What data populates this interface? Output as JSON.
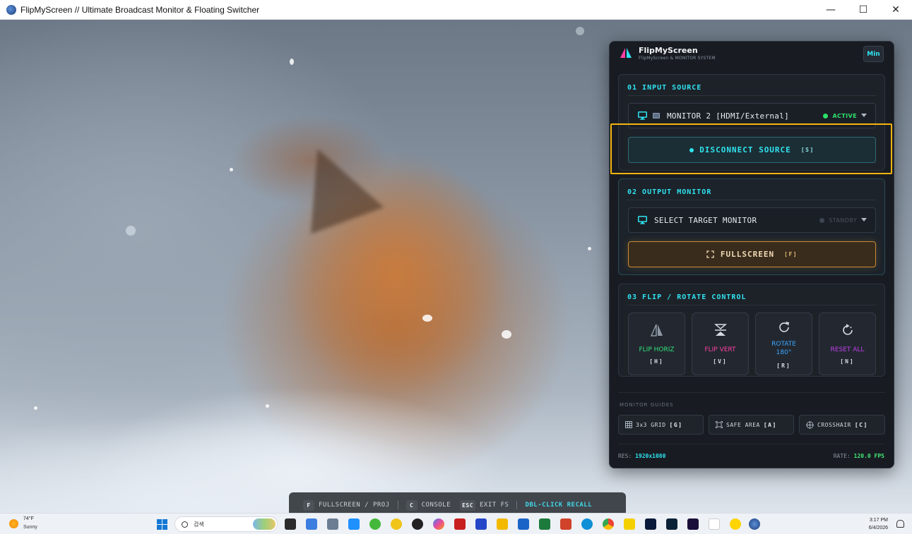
{
  "window": {
    "title": "FlipMyScreen // Ultimate Broadcast Monitor & Floating Switcher",
    "controls": {
      "minimize": "—",
      "maximize": "☐",
      "close": "✕"
    }
  },
  "panel": {
    "brand_title": "FlipMyScreen",
    "brand_subtitle": "FlipMyScreen & MONITOR SYSTEM",
    "min_label": "Min",
    "input": {
      "title": "01 INPUT SOURCE",
      "source_label": "MONITOR 2 [HDMI/External]",
      "status": "ACTIVE",
      "disconnect_label": "DISCONNECT SOURCE",
      "disconnect_key": "[S]"
    },
    "output": {
      "title": "02 OUTPUT MONITOR",
      "target_label": "SELECT TARGET MONITOR",
      "status": "STANDBY",
      "fullscreen_label": "FULLSCREEN",
      "fullscreen_key": "[F]"
    },
    "flip": {
      "title": "03 FLIP / ROTATE CONTROL",
      "tiles": [
        {
          "label": "FLIP HORIZ",
          "key": "[H]",
          "color": "#2fe37a"
        },
        {
          "label": "FLIP VERT",
          "key": "[V]",
          "color": "#ff3fa6"
        },
        {
          "label_line1": "ROTATE",
          "label_line2": "180°",
          "key": "[R]",
          "color": "#3aa6ff"
        },
        {
          "label": "RESET ALL",
          "key": "[N]",
          "color": "#c13ef0"
        }
      ]
    },
    "guides": {
      "title": "MONITOR GUIDES",
      "items": [
        {
          "label": "3x3 GRID",
          "key": "[G]"
        },
        {
          "label": "SAFE AREA",
          "key": "[A]"
        },
        {
          "label": "CROSSHAIR",
          "key": "[C]"
        }
      ]
    },
    "footer": {
      "res_label": "RES:",
      "res_value": "1920x1080",
      "rate_label": "RATE:",
      "rate_value": "120.0 FPS"
    }
  },
  "hotbar": {
    "items": [
      {
        "key": "F",
        "label": "FULLSCREEN / PROJ"
      },
      {
        "key": "C",
        "label": "CONSOLE"
      },
      {
        "key": "ESC",
        "label": "EXIT FS"
      }
    ],
    "recall": "DBL-CLICK RECALL"
  },
  "taskbar": {
    "weather_temp": "74°F",
    "weather_condition": "Sunny",
    "search_placeholder": "검색",
    "time": "3:17 PM",
    "date": "6/4/2026"
  }
}
